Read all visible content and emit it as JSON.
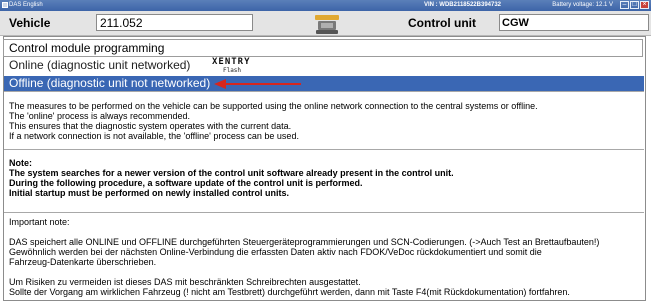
{
  "window": {
    "title": "DAS English",
    "vin": "VIN : WDB2118522B394732",
    "battery": "Battery voltage: 12.1 V"
  },
  "header": {
    "vehicle_label": "Vehicle",
    "vehicle_value": "211.052",
    "control_unit_label": "Control unit",
    "control_unit_value": "CGW"
  },
  "module_title": "Control module programming",
  "options": [
    {
      "label": "Online (diagnostic unit networked)",
      "selected": false
    },
    {
      "label": "Offline (diagnostic unit not networked)",
      "selected": true
    }
  ],
  "logo": {
    "brand": "XENTRY",
    "sub": "Flash"
  },
  "info": [
    "The measures to be performed on the vehicle can be supported using the online network connection to the central systems or offline.",
    "The 'online' process is always recommended.",
    "This ensures that the diagnostic system operates with the current data.",
    "If a network connection is not available, the 'offline' process can be used."
  ],
  "note": {
    "title": "Note:",
    "lines": [
      "The system searches for a newer version of the control unit software already present in the control unit.",
      "During the following procedure, a software update of the control unit is performed.",
      "Initial startup must be performed on newly installed control units."
    ]
  },
  "important": {
    "title": "Important note:",
    "lines": [
      "DAS speichert alle ONLINE und OFFLINE durchgeführten Steuergeräteprogrammierungen und SCN-Codierungen. (->Auch Test an Brettaufbauten!)",
      "Gewöhnlich werden bei der nächsten Online-Verbindung die erfassten Daten aktiv nach FDOK/VeDoc rückdokumentiert und somit die",
      "Fahrzeug-Datenkarte überschrieben.",
      "Um Risiken zu vermeiden ist dieses DAS mit beschränkten Schreibrechten ausgestattet.",
      "Sollte der Vorgang am wirklichen Fahrzeug (! nicht am Testbrett) durchgeführt werden, dann mit Taste F4(mit Rückdokumentation) fortfahren."
    ]
  },
  "colors": {
    "selection": "#3a67b4",
    "arrow": "#d6261e",
    "titlebar": "#3d64a8"
  }
}
